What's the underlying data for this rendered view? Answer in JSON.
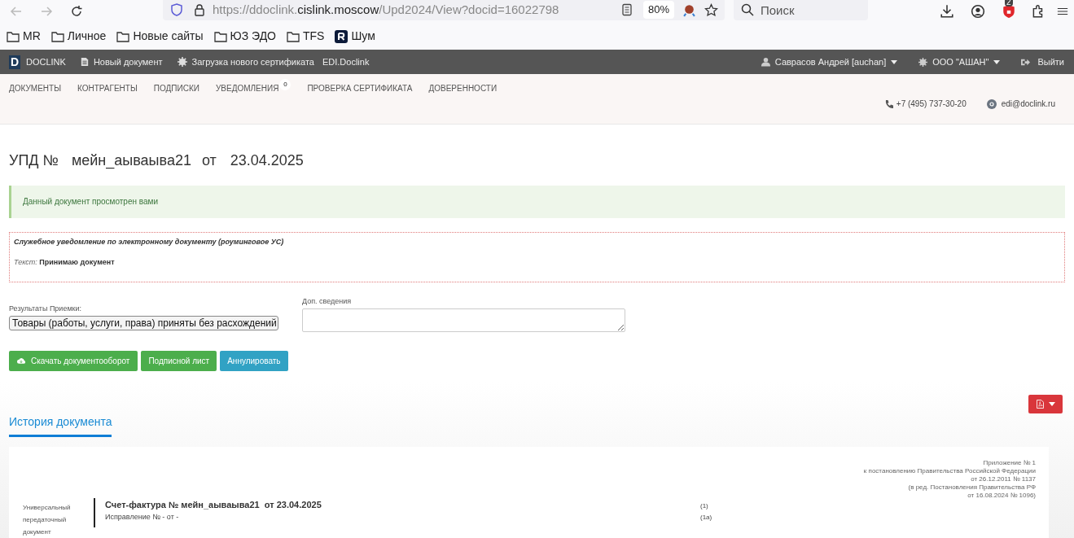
{
  "browser": {
    "url_parts": [
      "https://ddoclink.",
      "cislink.moscow",
      "/Upd2024/View?docid=16022798"
    ],
    "zoom": "80%",
    "search": {
      "placeholder": "Поиск"
    },
    "shield_badge": "2"
  },
  "bookmarks": [
    {
      "label": "MR",
      "kind": "folder"
    },
    {
      "label": "Личное",
      "kind": "folder"
    },
    {
      "label": "Новые сайты",
      "kind": "folder"
    },
    {
      "label": "ЮЗ ЭДО",
      "kind": "folder"
    },
    {
      "label": "TFS",
      "kind": "folder"
    },
    {
      "label": "Шум",
      "kind": "app"
    }
  ],
  "app_bar": {
    "logo": "D",
    "brand": "DOCLINK",
    "links": [
      {
        "label": "Новый документ",
        "kind": "document"
      },
      {
        "label": "Загрузка нового сертификата",
        "kind": "certificate"
      },
      {
        "label": "EDI.Doclink",
        "kind": "plain"
      }
    ],
    "user": "Саврасов Андрей [auchan]",
    "org": "ООО \"АШАН\"",
    "logout": "Выйти"
  },
  "nav": [
    {
      "label": "ДОКУМЕНТЫ"
    },
    {
      "label": "КОНТРАГЕНТЫ"
    },
    {
      "label": "ПОДПИСКИ"
    },
    {
      "label": "УВЕДОМЛЕНИЯ",
      "count": "0"
    },
    {
      "label": "ПРОВЕРКА СЕРТИФИКАТА"
    },
    {
      "label": "ДОВЕРЕННОСТИ"
    }
  ],
  "contacts": {
    "phone": "+7 (495) 737-30-20",
    "email": "edi@doclink.ru"
  },
  "title": {
    "prefix": "УПД №",
    "number": "мейн_аываыва21",
    "from": "от",
    "date": "23.04.2025"
  },
  "alert": "Данный документ просмотрен вами",
  "notice": {
    "title": "Служебное уведомление по электронному документу (роуминговое УС)",
    "text_label": "Текст:",
    "text_value": "Принимаю документ"
  },
  "form": {
    "result_label": "Результаты Приемки:",
    "result_value": "Товары (работы, услуги, права) приняты без расхождений",
    "extra_label": "Доп. сведения"
  },
  "buttons": [
    {
      "label": "Скачать документооборот",
      "kind": "download"
    },
    {
      "label": "Подписной лист",
      "kind": "success"
    },
    {
      "label": "Аннулировать",
      "kind": "info"
    }
  ],
  "tabs": [
    {
      "label": "История документа",
      "selected": true
    }
  ],
  "document": {
    "appendix": [
      "Приложение № 1",
      "к постановлению Правительства Российской Федерации",
      "от 26.12.2011 № 1137",
      "(в ред. Постановления Правительства РФ",
      "от 16.08.2024 № 1096)"
    ],
    "side_label": "Универсальный передаточный документ",
    "rows": [
      {
        "text": "Счет-фактура № мейн_аываыва21  от 23.04.2025",
        "kind": "heading",
        "marker": "(1)"
      },
      {
        "text": "Исправление № - от -",
        "kind": "sub",
        "marker": "(1а)"
      }
    ]
  }
}
